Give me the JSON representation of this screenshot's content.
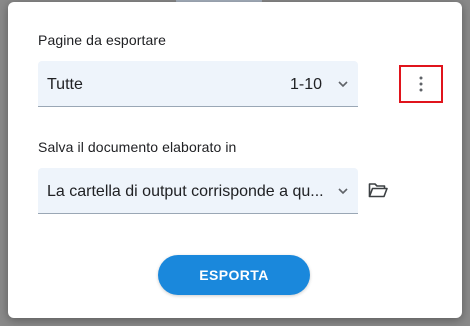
{
  "pages_section": {
    "label": "Pagine da esportare",
    "selected_value": "Tutte",
    "range": "1-10"
  },
  "save_section": {
    "label": "Salva il documento elaborato in",
    "selected_value": "La cartella di output corrisponde a qu..."
  },
  "actions": {
    "export_label": "ESPORTA"
  },
  "icons": {
    "more": "more-vertical-icon",
    "folder": "folder-open-icon",
    "chevron": "chevron-down-icon"
  },
  "colors": {
    "accent": "#1a88dc",
    "highlight_border": "#e0141c",
    "field_background": "#eef4fb"
  }
}
